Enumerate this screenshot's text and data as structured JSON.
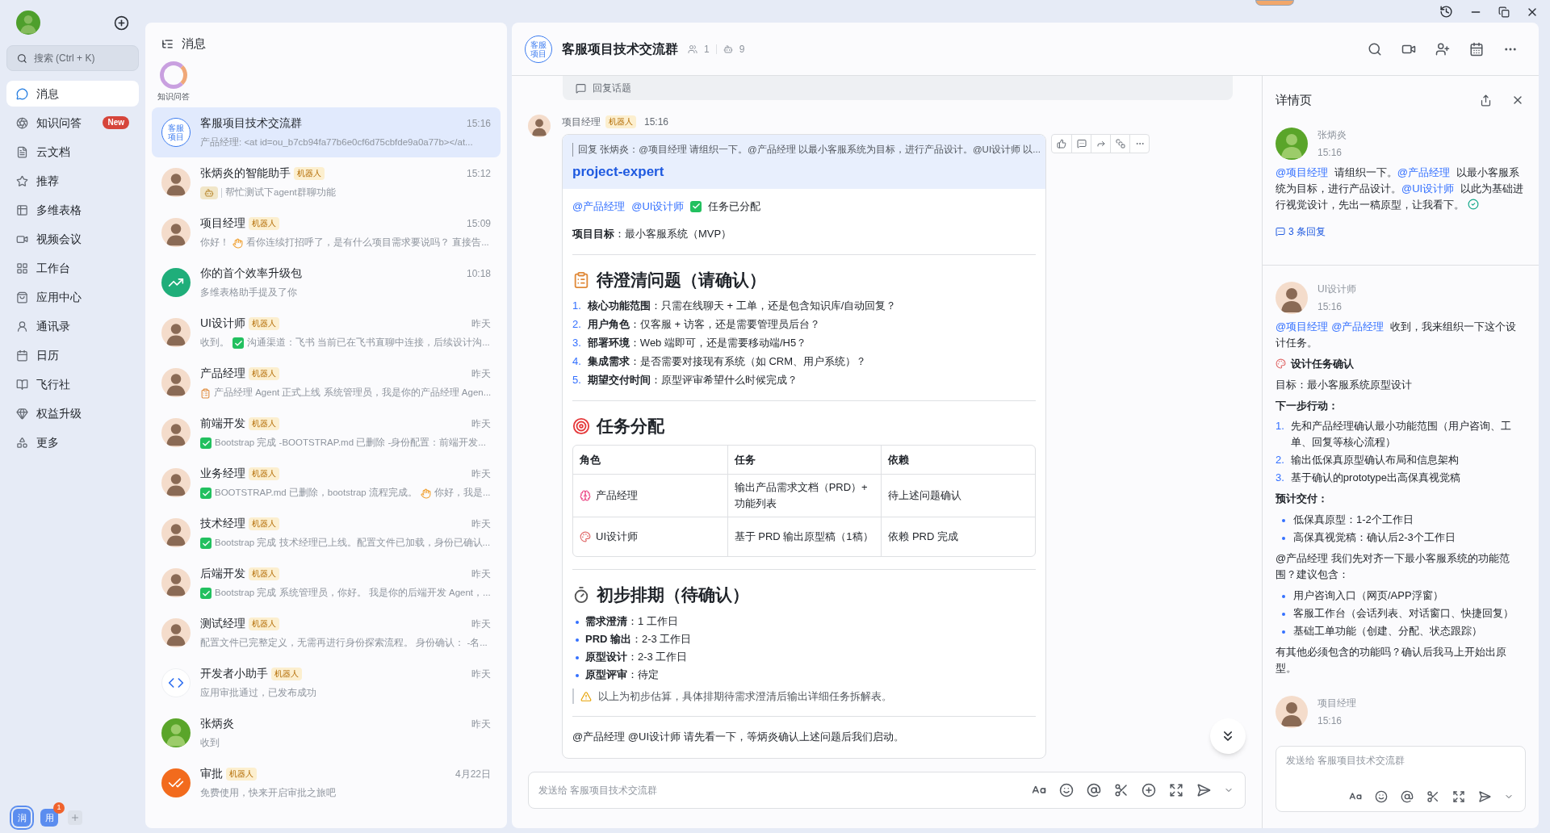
{
  "nav": {
    "search": {
      "placeholder": "搜索 (Ctrl + K)"
    },
    "items": [
      {
        "label": "消息",
        "selected": true
      },
      {
        "label": "知识问答",
        "selected": false,
        "badge": "New"
      },
      {
        "label": "云文档",
        "selected": false
      },
      {
        "label": "推荐",
        "selected": false
      },
      {
        "label": "多维表格",
        "selected": false
      },
      {
        "label": "视频会议",
        "selected": false
      },
      {
        "label": "工作台",
        "selected": false
      },
      {
        "label": "应用中心",
        "selected": false
      },
      {
        "label": "通讯录",
        "selected": false
      },
      {
        "label": "日历",
        "selected": false
      },
      {
        "label": "飞行社",
        "selected": false
      },
      {
        "label": "权益升级",
        "selected": false
      },
      {
        "label": "更多",
        "selected": false
      }
    ],
    "apps": [
      {
        "label": "润",
        "selected": true
      },
      {
        "label": "用",
        "selected": false,
        "badge": "1"
      }
    ]
  },
  "chat_list": {
    "title": "消息",
    "pinned": {
      "label": "知识问答"
    },
    "rows": [
      {
        "name": "客服项目技术交流群",
        "time": "15:16",
        "selected": true,
        "avatar": {
          "kind": "group",
          "text": "客服项目"
        },
        "preview": [
          {
            "kind": "text",
            "text": "产品经理: <at id=ou_b7cb94fa77b6e0cf6d75cbfde9a0a77b></at..."
          }
        ]
      },
      {
        "name": "张炳炎的智能助手",
        "tag": "机器人",
        "time": "15:12",
        "selected": false,
        "avatar": {
          "kind": "person"
        },
        "preview": [
          {
            "kind": "bot"
          },
          {
            "kind": "sep"
          },
          {
            "kind": "text",
            "text": "帮忙测试下agent群聊功能"
          }
        ]
      },
      {
        "name": "项目经理",
        "tag": "机器人",
        "time": "15:09",
        "selected": false,
        "avatar": {
          "kind": "person"
        },
        "preview": [
          {
            "kind": "text",
            "text": "你好！"
          },
          {
            "kind": "hand"
          },
          {
            "kind": "text",
            "text": "看你连续打招呼了，是有什么项目需求要说吗？ 直接告..."
          }
        ]
      },
      {
        "name": "你的首个效率升级包",
        "time": "10:18",
        "selected": false,
        "avatar": {
          "kind": "chart"
        },
        "preview": [
          {
            "kind": "text",
            "text": "多维表格助手提及了你"
          }
        ]
      },
      {
        "name": "UI设计师",
        "tag": "机器人",
        "time": "昨天",
        "selected": false,
        "avatar": {
          "kind": "person"
        },
        "preview": [
          {
            "kind": "text",
            "text": "收到。"
          },
          {
            "kind": "check"
          },
          {
            "kind": "text",
            "text": "沟通渠道：飞书 当前已在飞书直聊中连接，后续设计沟..."
          }
        ]
      },
      {
        "name": "产品经理",
        "tag": "机器人",
        "time": "昨天",
        "selected": false,
        "avatar": {
          "kind": "person"
        },
        "preview": [
          {
            "kind": "doc"
          },
          {
            "kind": "text",
            "text": "产品经理 Agent 正式上线 系统管理员，我是你的产品经理 Agen..."
          }
        ]
      },
      {
        "name": "前端开发",
        "tag": "机器人",
        "time": "昨天",
        "selected": false,
        "avatar": {
          "kind": "person"
        },
        "preview": [
          {
            "kind": "check"
          },
          {
            "kind": "text",
            "text": "Bootstrap 完成 -BOOTSTRAP.md 已删除 -身份配置：前端开发..."
          }
        ]
      },
      {
        "name": "业务经理",
        "tag": "机器人",
        "time": "昨天",
        "selected": false,
        "avatar": {
          "kind": "person"
        },
        "preview": [
          {
            "kind": "check"
          },
          {
            "kind": "text",
            "text": "BOOTSTRAP.md 已删除，bootstrap 流程完成。"
          },
          {
            "kind": "hand"
          },
          {
            "kind": "text",
            "text": "你好，我是..."
          }
        ]
      },
      {
        "name": "技术经理",
        "tag": "机器人",
        "time": "昨天",
        "selected": false,
        "avatar": {
          "kind": "person"
        },
        "preview": [
          {
            "kind": "check"
          },
          {
            "kind": "text",
            "text": "Bootstrap 完成 技术经理已上线。配置文件已加载，身份已确认..."
          }
        ]
      },
      {
        "name": "后端开发",
        "tag": "机器人",
        "time": "昨天",
        "selected": false,
        "avatar": {
          "kind": "person"
        },
        "preview": [
          {
            "kind": "check"
          },
          {
            "kind": "text",
            "text": "Bootstrap 完成 系统管理员，你好。 我是你的后端开发 Agent，..."
          }
        ]
      },
      {
        "name": "测试经理",
        "tag": "机器人",
        "time": "昨天",
        "selected": false,
        "avatar": {
          "kind": "person"
        },
        "preview": [
          {
            "kind": "text",
            "text": "配置文件已完整定义，无需再进行身份探索流程。 身份确认： -名..."
          }
        ]
      },
      {
        "name": "开发者小助手",
        "tag": "机器人",
        "time": "昨天",
        "selected": false,
        "avatar": {
          "kind": "code"
        },
        "preview": [
          {
            "kind": "text",
            "text": "应用审批通过，已发布成功"
          }
        ]
      },
      {
        "name": "张炳炎",
        "time": "昨天",
        "selected": false,
        "avatar": {
          "kind": "user"
        },
        "preview": [
          {
            "kind": "text",
            "text": "收到"
          }
        ]
      },
      {
        "name": "审批",
        "tag": "机器人",
        "time": "4月22日",
        "selected": false,
        "avatar": {
          "kind": "approval"
        },
        "preview": [
          {
            "kind": "text",
            "text": "免费使用，快来开启审批之旅吧"
          }
        ]
      }
    ]
  },
  "chat": {
    "title": "客服项目技术交流群",
    "avatar_text": "客服项目",
    "members": "1",
    "bots": "9",
    "reply_topic": "回复话题",
    "message": {
      "sender": "项目经理",
      "tag": "机器人",
      "time": "15:16",
      "quote": "回复 张炳炎：@项目经理 请组织一下。@产品经理 以最小客服系统为目标，进行产品设计。@UI设计师 以...",
      "title": "project-expert",
      "blocks": [
        {
          "kind": "mentions",
          "parts": [
            {
              "kind": "mention",
              "text": "@产品经理"
            },
            {
              "kind": "mention",
              "text": "@UI设计师"
            },
            {
              "kind": "check"
            },
            {
              "kind": "text",
              "text": "任务已分配"
            }
          ]
        },
        {
          "kind": "line",
          "text": "**项目目标**：最小客服系统（MVP）"
        },
        {
          "kind": "divider"
        },
        {
          "kind": "heading",
          "text": "待澄清问题（请确认）"
        },
        {
          "kind": "ordered",
          "items": [
            {
              "number": "1.",
              "text": "**核心功能范围**：只需在线聊天 + 工单，还是包含知识库/自动回复？"
            },
            {
              "number": "2.",
              "text": "**用户角色**：仅客服 + 访客，还是需要管理员后台？"
            },
            {
              "number": "3.",
              "text": "**部署环境**：Web 端即可，还是需要移动端/H5？"
            },
            {
              "number": "4.",
              "text": "**集成需求**：是否需要对接现有系统（如 CRM、用户系统）？"
            },
            {
              "number": "5.",
              "text": "**期望交付时间**：原型评审希望什么时候完成？"
            }
          ]
        },
        {
          "kind": "divider"
        },
        {
          "kind": "heading",
          "text": "任务分配"
        },
        {
          "kind": "table",
          "columns": [
            "角色",
            "任务",
            "依赖"
          ],
          "rows": [
            {
              "cells": [
                "产品经理",
                "输出产品需求文档（PRD）+ 功能列表",
                "待上述问题确认"
              ]
            },
            {
              "cells": [
                "UI设计师",
                "基于 PRD 输出原型稿（1稿）",
                "依赖 PRD 完成"
              ]
            }
          ]
        },
        {
          "kind": "divider"
        },
        {
          "kind": "heading",
          "text": "初步排期（待确认）"
        },
        {
          "kind": "bullets",
          "items": [
            "**需求澄清**：1 工作日",
            "**PRD 输出**：2-3 工作日",
            "**原型设计**：2-3 工作日",
            "**原型评审**：待定"
          ]
        },
        {
          "kind": "note",
          "text": "以上为初步估算，具体排期待需求澄清后输出详细任务拆解表。"
        },
        {
          "kind": "divider"
        },
        {
          "kind": "line",
          "text": "@产品经理 @UI设计师 请先看一下，等炳炎确认上述问题后我们启动。"
        }
      ]
    },
    "input_placeholder": "发送给 客服项目技术交流群"
  },
  "detail": {
    "title": "详情页",
    "messages": [
      {
        "sender": "张炳炎",
        "time": "15:16",
        "avatar": {
          "kind": "user"
        },
        "replies": "3 条回复",
        "blocks": [
          {
            "kind": "para",
            "parts": [
              {
                "kind": "mention",
                "text": "@项目经理"
              },
              {
                "kind": "text",
                "text": " 请组织一下。"
              },
              {
                "kind": "mention",
                "text": "@产品经理"
              },
              {
                "kind": "text",
                "text": " 以最小客服系统为目标，进行产品设计。"
              },
              {
                "kind": "mention",
                "text": "@UI设计师"
              },
              {
                "kind": "text",
                "text": " 以此为基础进行视觉设计，先出一稿原型，让我看下。"
              },
              {
                "kind": "done"
              }
            ]
          }
        ]
      },
      {
        "sender": "UI设计师",
        "time": "15:16",
        "avatar": {
          "kind": "person"
        },
        "blocks": [
          {
            "kind": "para",
            "parts": [
              {
                "kind": "mention",
                "text": "@项目经理"
              },
              {
                "kind": "mention",
                "text": "@产品经理"
              },
              {
                "kind": "text",
                "text": " 收到，我来组织一下这个设计任务。"
              }
            ]
          },
          {
            "kind": "subheading",
            "text": "设计任务确认"
          },
          {
            "kind": "line",
            "text": "目标：最小客服系统原型设计"
          },
          {
            "kind": "label",
            "text": "下一步行动："
          },
          {
            "kind": "ordered",
            "items": [
              {
                "number": "1.",
                "text": "先和产品经理确认最小功能范围（用户咨询、工单、回复等核心流程）"
              },
              {
                "number": "2.",
                "text": "输出低保真原型确认布局和信息架构"
              },
              {
                "number": "3.",
                "text": "基于确认的prototype出高保真视觉稿"
              }
            ]
          },
          {
            "kind": "label",
            "text": "预计交付："
          },
          {
            "kind": "bullets",
            "items": [
              "低保真原型：1-2个工作日",
              "高保真视觉稿：确认后2-3个工作日"
            ]
          },
          {
            "kind": "line",
            "text": "@产品经理 我们先对齐一下最小客服系统的功能范围？建议包含："
          },
          {
            "kind": "bullets",
            "items": [
              "用户咨询入口（网页/APP浮窗）",
              "客服工作台（会话列表、对话窗口、快捷回复）",
              "基础工单功能（创建、分配、状态跟踪）"
            ]
          },
          {
            "kind": "line",
            "text": "有其他必须包含的功能吗？确认后我马上开始出原型。"
          }
        ]
      },
      {
        "sender": "项目经理",
        "time": "15:16",
        "avatar": {
          "kind": "person"
        }
      }
    ],
    "input_placeholder": "发送给 客服项目技术交流群"
  }
}
